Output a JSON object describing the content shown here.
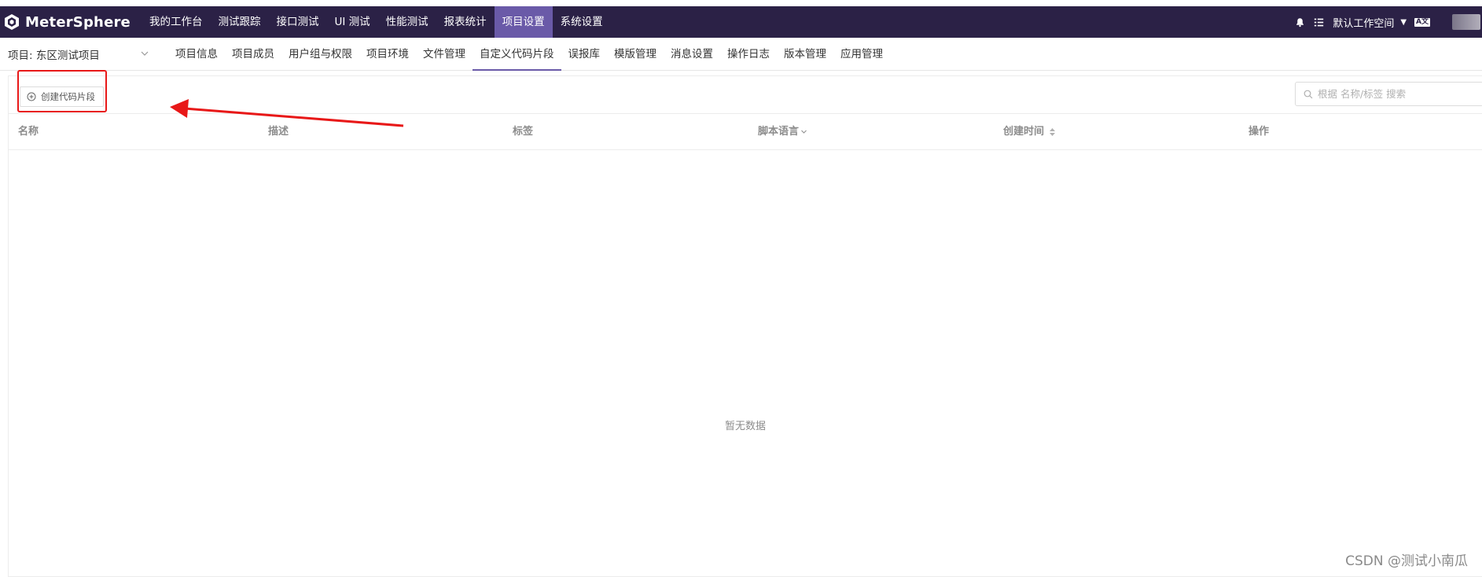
{
  "app": {
    "name": "MeterSphere"
  },
  "topnav": {
    "items": [
      {
        "label": "我的工作台",
        "active": false
      },
      {
        "label": "测试跟踪",
        "active": false
      },
      {
        "label": "接口测试",
        "active": false
      },
      {
        "label": "UI 测试",
        "active": false
      },
      {
        "label": "性能测试",
        "active": false
      },
      {
        "label": "报表统计",
        "active": false
      },
      {
        "label": "项目设置",
        "active": true
      },
      {
        "label": "系统设置",
        "active": false
      }
    ],
    "workspace_label": "默认工作空间",
    "lang_badge": "A文",
    "icons": [
      "bell-icon",
      "task-list-icon",
      "chevron-down-icon",
      "language-icon"
    ]
  },
  "project": {
    "label": "项目: 东区测试项目"
  },
  "subnav": {
    "items": [
      {
        "label": "项目信息",
        "active": false
      },
      {
        "label": "项目成员",
        "active": false
      },
      {
        "label": "用户组与权限",
        "active": false
      },
      {
        "label": "项目环境",
        "active": false
      },
      {
        "label": "文件管理",
        "active": false
      },
      {
        "label": "自定义代码片段",
        "active": true
      },
      {
        "label": "误报库",
        "active": false
      },
      {
        "label": "模版管理",
        "active": false
      },
      {
        "label": "消息设置",
        "active": false
      },
      {
        "label": "操作日志",
        "active": false
      },
      {
        "label": "版本管理",
        "active": false
      },
      {
        "label": "应用管理",
        "active": false
      }
    ]
  },
  "toolbar": {
    "create_label": "创建代码片段",
    "search_placeholder": "根据 名称/标签 搜索"
  },
  "table": {
    "columns": [
      "名称",
      "描述",
      "标签",
      "脚本语言",
      "创建时间",
      "操作"
    ],
    "rows": [],
    "empty_text": "暂无数据"
  },
  "watermark": "CSDN @测试小南瓜",
  "colors": {
    "topbar": "#2b2146",
    "accent": "#6a5aa8",
    "annotation_red": "#e81818"
  }
}
